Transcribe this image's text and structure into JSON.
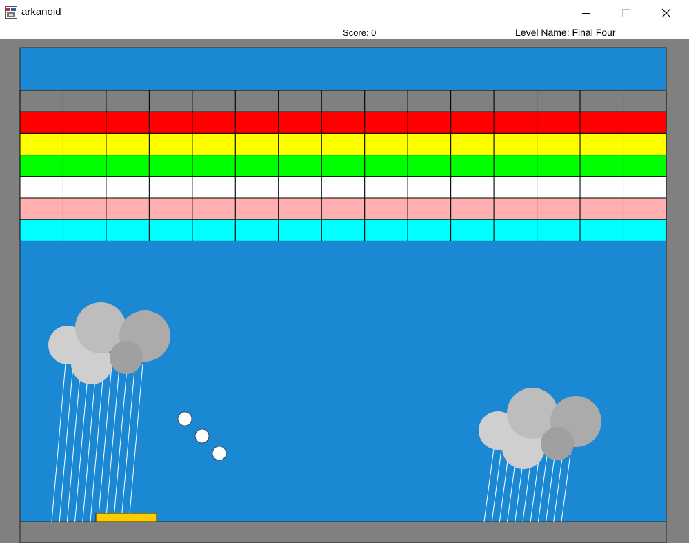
{
  "window": {
    "title": "arkanoid",
    "controls": {
      "minimize": "minimize",
      "maximize": "maximize",
      "close": "close"
    }
  },
  "hud": {
    "score": "Score: 0",
    "level_name": "Level Name: Final Four"
  },
  "colors": {
    "background": "#1b88d4",
    "border": "#808080",
    "paddle": "#ffcc00",
    "ball": "#ffffff",
    "rain": "#ffffff"
  },
  "blocks": {
    "columns": 15,
    "rows": [
      {
        "name": "gray",
        "color": "#808080"
      },
      {
        "name": "red",
        "color": "#ff0000"
      },
      {
        "name": "yellow",
        "color": "#ffff00"
      },
      {
        "name": "green",
        "color": "#00ff00"
      },
      {
        "name": "white",
        "color": "#ffffff"
      },
      {
        "name": "pink",
        "color": "#ffafaf"
      },
      {
        "name": "cyan",
        "color": "#00ffff"
      }
    ]
  },
  "balls": {
    "count": 3
  },
  "clouds": {
    "count": 2
  }
}
